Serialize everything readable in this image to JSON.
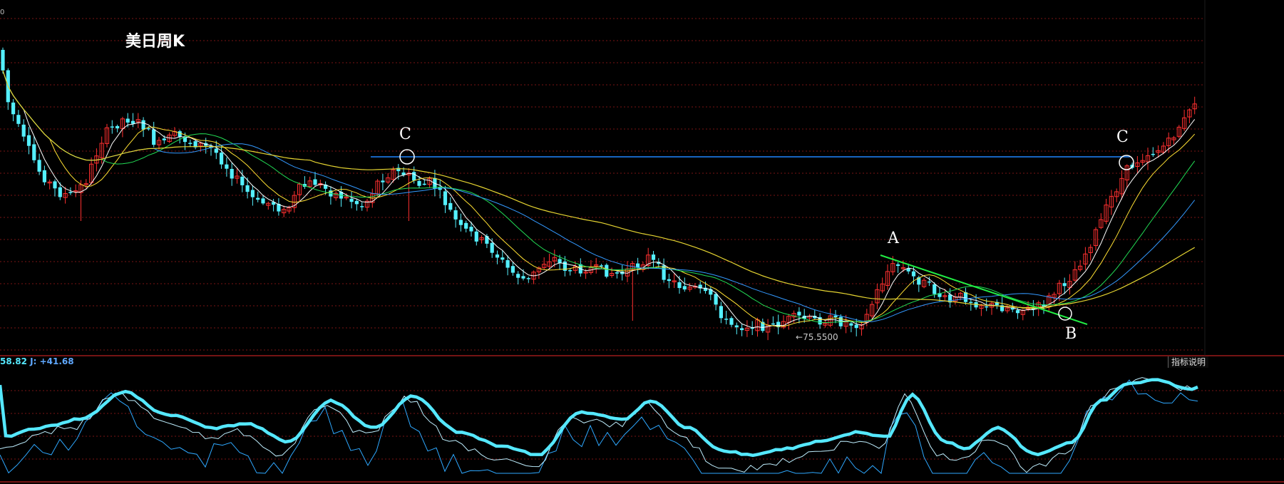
{
  "title": "美日周K",
  "axis_top_label": "0",
  "annotations": {
    "c_left": "C",
    "c_right": "C",
    "a": "A",
    "b": "B",
    "low_price": "75.5500"
  },
  "indicator": {
    "value_text": "58.82",
    "j_text": "J: +41.68",
    "help_label": "指标说明"
  },
  "colors": {
    "background": "#000000",
    "up_candle": "#ff3030",
    "down_candle": "#54f0ff",
    "ma_fast": "#ffffff",
    "ma_mid": "#ffe033",
    "ma_green": "#22dd55",
    "ma_blue": "#3399ff",
    "ma_slow": "#e5d431",
    "resistance_line": "#1f86ff",
    "trend_line": "#22ee44",
    "kdj_k": "#55e8ff",
    "kdj_d": "#bfefff",
    "kdj_j": "#2ea8ff",
    "grid": "#7a1414"
  },
  "chart_data": {
    "type": "candlestick",
    "title": "美日周K",
    "low_marked": 75.55,
    "series": []
  }
}
